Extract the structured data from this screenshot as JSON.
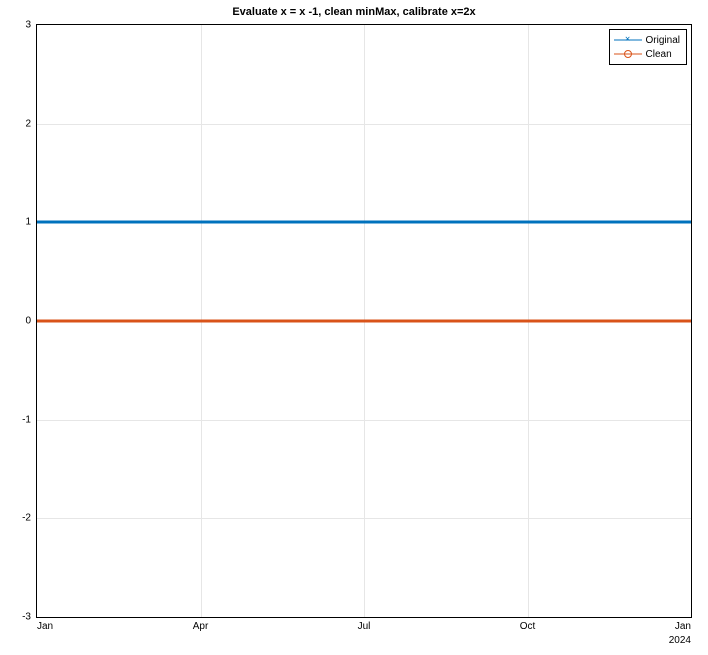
{
  "chart_data": {
    "type": "line",
    "title": "Evaluate x = x -1, clean minMax, calibrate x=2x",
    "xlabel": "",
    "ylabel": "",
    "xlim": [
      "Jan",
      "Jan"
    ],
    "ylim": [
      -3,
      3
    ],
    "x_ticks": [
      "Jan",
      "Apr",
      "Jul",
      "Oct",
      "Jan"
    ],
    "y_ticks": [
      -3,
      -2,
      -1,
      0,
      1,
      2,
      3
    ],
    "year_label": "2024",
    "series": [
      {
        "name": "Original",
        "color": "#0072BD",
        "marker": "x",
        "values": [
          1,
          1,
          1,
          1,
          1
        ]
      },
      {
        "name": "Clean",
        "color": "#D95319",
        "marker": "o",
        "values": [
          0,
          0,
          0,
          0,
          0
        ]
      }
    ],
    "categories": [
      "Jan",
      "Apr",
      "Jul",
      "Oct",
      "Jan"
    ]
  },
  "legend": {
    "items": [
      {
        "label": "Original"
      },
      {
        "label": "Clean"
      }
    ]
  }
}
